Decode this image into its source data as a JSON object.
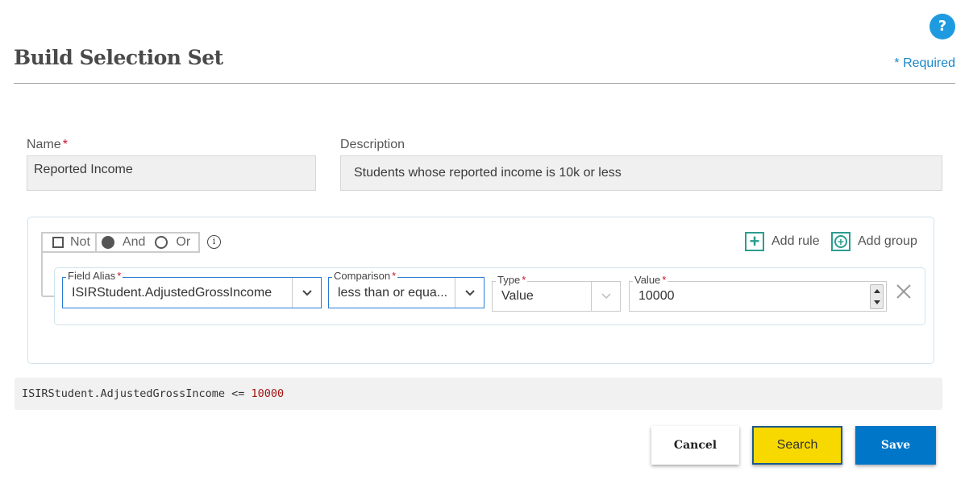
{
  "header": {
    "title": "Build Selection Set",
    "help_icon": "?",
    "required_note": "* Required"
  },
  "form": {
    "name": {
      "label": "Name",
      "required_mark": "*",
      "value": "Reported Income"
    },
    "description": {
      "label": "Description",
      "value": "Students whose reported income is 10k or less"
    }
  },
  "query_builder": {
    "logic": {
      "not_label": "Not",
      "not_checked": false,
      "and_label": "And",
      "or_label": "Or",
      "selected": "And"
    },
    "add_rule_label": "Add rule",
    "add_group_label": "Add group",
    "rules": [
      {
        "field_alias": {
          "label": "Field Alias",
          "required_mark": "*",
          "value": "ISIRStudent.AdjustedGrossIncome"
        },
        "comparison": {
          "label": "Comparison",
          "required_mark": "*",
          "value": "less than or equa..."
        },
        "type": {
          "label": "Type",
          "required_mark": "*",
          "value": "Value"
        },
        "value": {
          "label": "Value",
          "required_mark": "*",
          "value": "10000"
        }
      }
    ]
  },
  "preview": {
    "field": "ISIRStudent.AdjustedGrossIncome",
    "operator": "<=",
    "value": "10000"
  },
  "actions": {
    "cancel": "Cancel",
    "search": "Search",
    "save": "Save"
  },
  "colors": {
    "accent_blue": "#0076c8",
    "help_blue": "#1e9be0",
    "search_yellow": "#f7d900",
    "add_teal": "#2a9d8f",
    "required_red": "#c8102e"
  }
}
